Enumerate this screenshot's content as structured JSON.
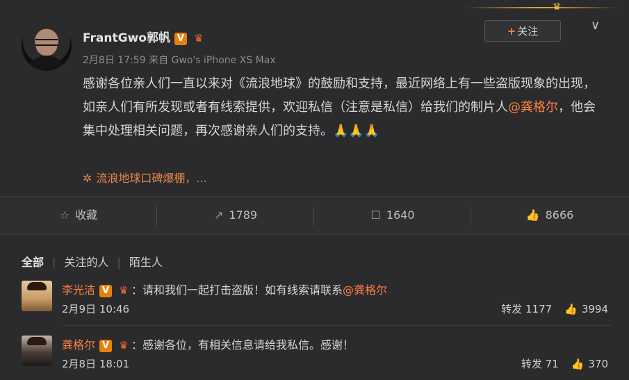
{
  "post": {
    "username": "FrantGwo郭帆",
    "verified_badge": "V",
    "vip_badge_icon": "crown-icon",
    "timestamp": "2月8日 17:59",
    "source": "来自 Gwo's iPhone XS Max",
    "follow_label": "关注",
    "content_part1": "感谢各位亲人们一直以来对《流浪地球》的鼓励和支持，最近网络上有一些盗版现象的出现，如亲人们有所发现或者有线索提供，欢迎私信（注意是私信）给我们的制片人",
    "content_mention": "@龚格尔",
    "content_part2": "，他会集中处理相关问题，再次感谢亲人们的支持。",
    "emoji": "🙏🙏🙏",
    "topic": "流浪地球口碑爆棚，..."
  },
  "actions": {
    "favorite_label": "收藏",
    "repost_count": "1789",
    "comment_count": "1640",
    "like_count": "8666"
  },
  "comments": {
    "filters": [
      "全部",
      "关注的人",
      "陌生人"
    ],
    "items": [
      {
        "author": "李光洁",
        "badge": "V",
        "text": "：请和我们一起打击盗版！如有线索请联系",
        "mention": "@龚格尔",
        "time": "2月9日 10:46",
        "repost_label": "转发 1177",
        "likes": "3994"
      },
      {
        "author": "龚格尔",
        "badge": "V",
        "text": "：感谢各位，有相关信息请给我私信。感谢！",
        "mention": "",
        "time": "2月8日 18:01",
        "repost_label": "转发 71",
        "likes": "370"
      }
    ]
  },
  "colors": {
    "background": "#2b2b2d",
    "accent_orange": "#ff8140",
    "verified_orange": "#e8810c",
    "text": "#d6d6d6"
  }
}
